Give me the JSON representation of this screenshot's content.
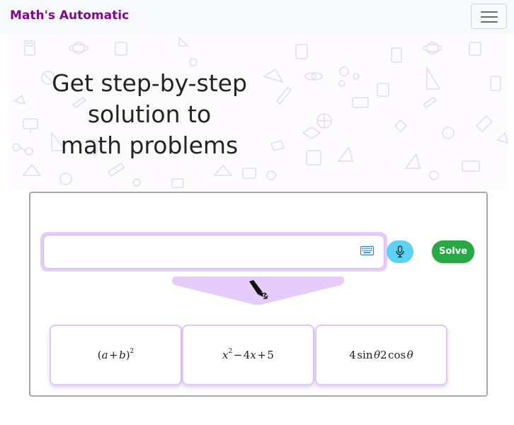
{
  "navbar": {
    "brand": "Math's Automatic",
    "brand_color": "#7f0a8c",
    "menu_icon": "hamburger-menu-icon"
  },
  "hero": {
    "title_line1": "Get step-by-step",
    "title_line2": "solution to",
    "title_line3": "math problems",
    "background_icons": [
      "calculator-icon",
      "atom-icon",
      "compass-icon",
      "microscope-icon",
      "graduation-cap-icon",
      "ruler-icon",
      "globe-icon",
      "telescope-icon",
      "molecule-icon",
      "tablet-icon"
    ]
  },
  "solver": {
    "input_value": "",
    "keyboard_icon": "keyboard-icon",
    "mic_icon": "microphone-icon",
    "solve_label": "Solve",
    "handwriting_icon": "pen-icon",
    "accent_color": "#e6ccfa",
    "solve_color": "#28a745",
    "mic_color": "#5cd3f2"
  },
  "examples": [
    {
      "expression": "(a+b)^2"
    },
    {
      "expression": "x^2-4x+5"
    },
    {
      "expression": "4 sin θ 2 cos θ"
    }
  ]
}
